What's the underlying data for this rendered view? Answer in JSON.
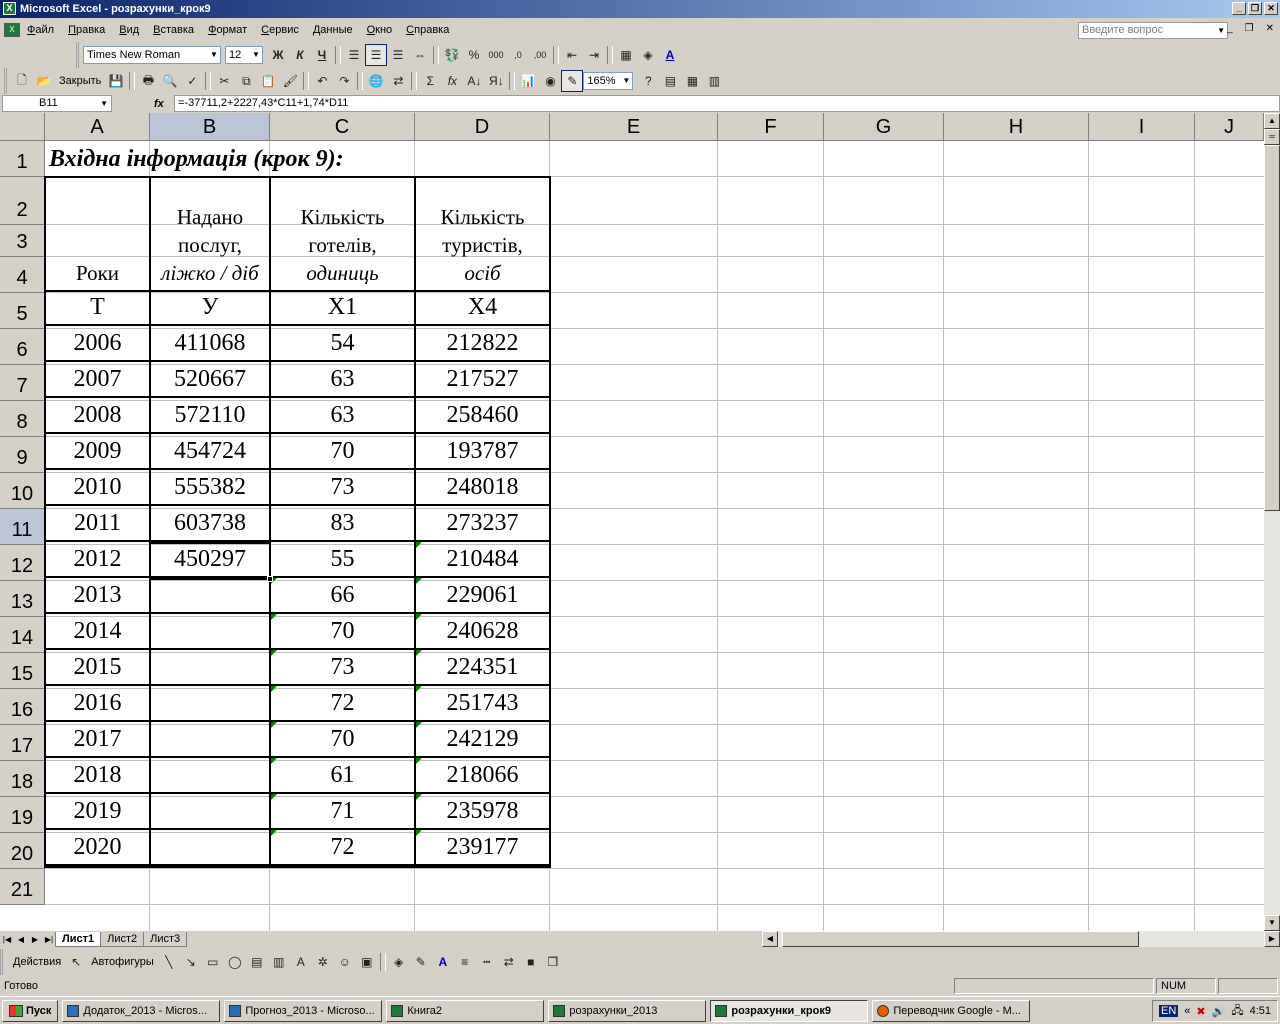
{
  "window": {
    "title": "Microsoft Excel - розрахунки_крок9"
  },
  "menu": [
    "Файл",
    "Правка",
    "Вид",
    "Вставка",
    "Формат",
    "Сервис",
    "Данные",
    "Окно",
    "Справка"
  ],
  "help_placeholder": "Введите вопрос",
  "format_toolbar": {
    "font": "Times New Roman",
    "size": "12"
  },
  "standard_toolbar": {
    "close_label": "Закрыть",
    "zoom": "165%"
  },
  "formula_bar": {
    "name_box": "B11",
    "fx": "fx",
    "formula": "=-37711,2+2227,43*C11+1,74*D11"
  },
  "columns": [
    "A",
    "B",
    "C",
    "D",
    "E",
    "F",
    "G",
    "H",
    "I",
    "J"
  ],
  "rows": [
    "1",
    "2",
    "3",
    "4",
    "5",
    "6",
    "7",
    "8",
    "9",
    "10",
    "11",
    "12",
    "13",
    "14",
    "15",
    "16",
    "17",
    "18",
    "19",
    "20",
    "21"
  ],
  "sheet": {
    "title": "Вхідна інформація (крок 9):",
    "headers": {
      "years": "Роки",
      "services_line1": "Надано",
      "services_line2": "послуг,",
      "services_unit": "ліжко / діб",
      "hotels_line1": "Кількість",
      "hotels_line2": "готелів,",
      "hotels_unit": "одиниць",
      "tourists_line1": "Кількість",
      "tourists_line2": "туристів,",
      "tourists_unit": "осіб"
    },
    "symbols": [
      "T",
      "У",
      "X1",
      "X4"
    ],
    "data": [
      [
        "2006",
        "411068",
        "54",
        "212822"
      ],
      [
        "2007",
        "520667",
        "63",
        "217527"
      ],
      [
        "2008",
        "572110",
        "63",
        "258460"
      ],
      [
        "2009",
        "454724",
        "70",
        "193787"
      ],
      [
        "2010",
        "555382",
        "73",
        "248018"
      ],
      [
        "2011",
        "603738",
        "83",
        "273237"
      ],
      [
        "2012",
        "450297",
        "55",
        "210484"
      ],
      [
        "2013",
        "",
        "66",
        "229061"
      ],
      [
        "2014",
        "",
        "70",
        "240628"
      ],
      [
        "2015",
        "",
        "73",
        "224351"
      ],
      [
        "2016",
        "",
        "72",
        "251743"
      ],
      [
        "2017",
        "",
        "70",
        "242129"
      ],
      [
        "2018",
        "",
        "61",
        "218066"
      ],
      [
        "2019",
        "",
        "71",
        "235978"
      ],
      [
        "2020",
        "",
        "72",
        "239177"
      ]
    ]
  },
  "sheet_tabs": [
    "Лист1",
    "Лист2",
    "Лист3"
  ],
  "drawing_toolbar": {
    "actions": "Действия",
    "autoshapes": "Автофигуры"
  },
  "status": {
    "ready": "Готово",
    "num": "NUM"
  },
  "taskbar": {
    "start": "Пуск",
    "items": [
      "Додаток_2013 - Micros...",
      "Прогноз_2013 - Microso...",
      "Книга2",
      "розрахунки_2013",
      "розрахунки_крок9",
      "Переводчик Google - M..."
    ],
    "lang": "EN",
    "clock": "4:51"
  }
}
